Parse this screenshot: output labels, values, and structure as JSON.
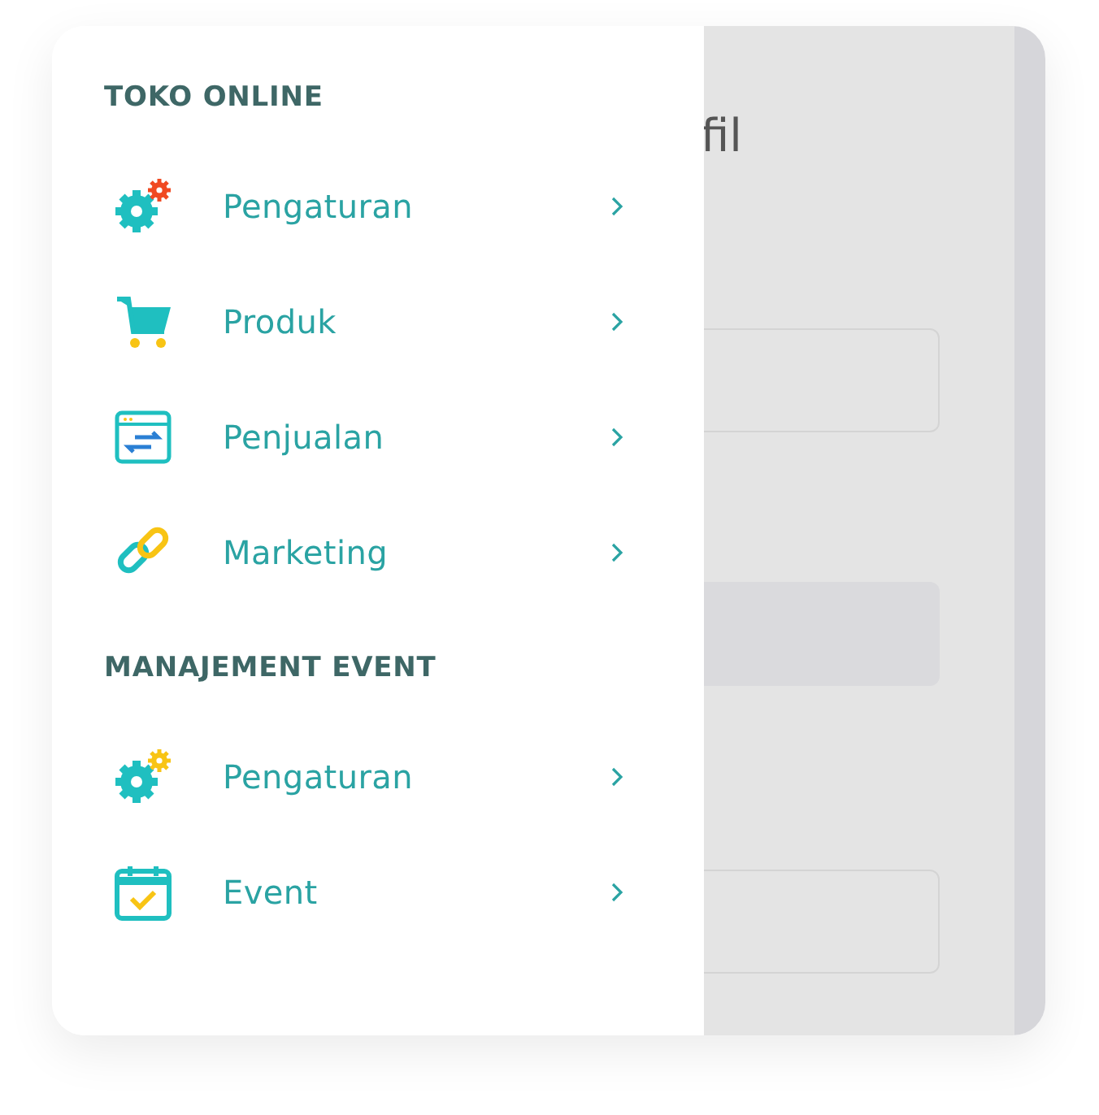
{
  "background_page": {
    "title": "fil"
  },
  "sections": [
    {
      "title": "TOKO ONLINE",
      "items": [
        {
          "label": "Pengaturan",
          "kind": "settings"
        },
        {
          "label": "Produk",
          "kind": "products"
        },
        {
          "label": "Penjualan",
          "kind": "sales"
        },
        {
          "label": "Marketing",
          "kind": "marketing"
        }
      ]
    },
    {
      "title": "MANAJEMENT EVENT",
      "items": [
        {
          "label": "Pengaturan",
          "kind": "event-settings"
        },
        {
          "label": "Event",
          "kind": "event"
        }
      ]
    }
  ]
}
